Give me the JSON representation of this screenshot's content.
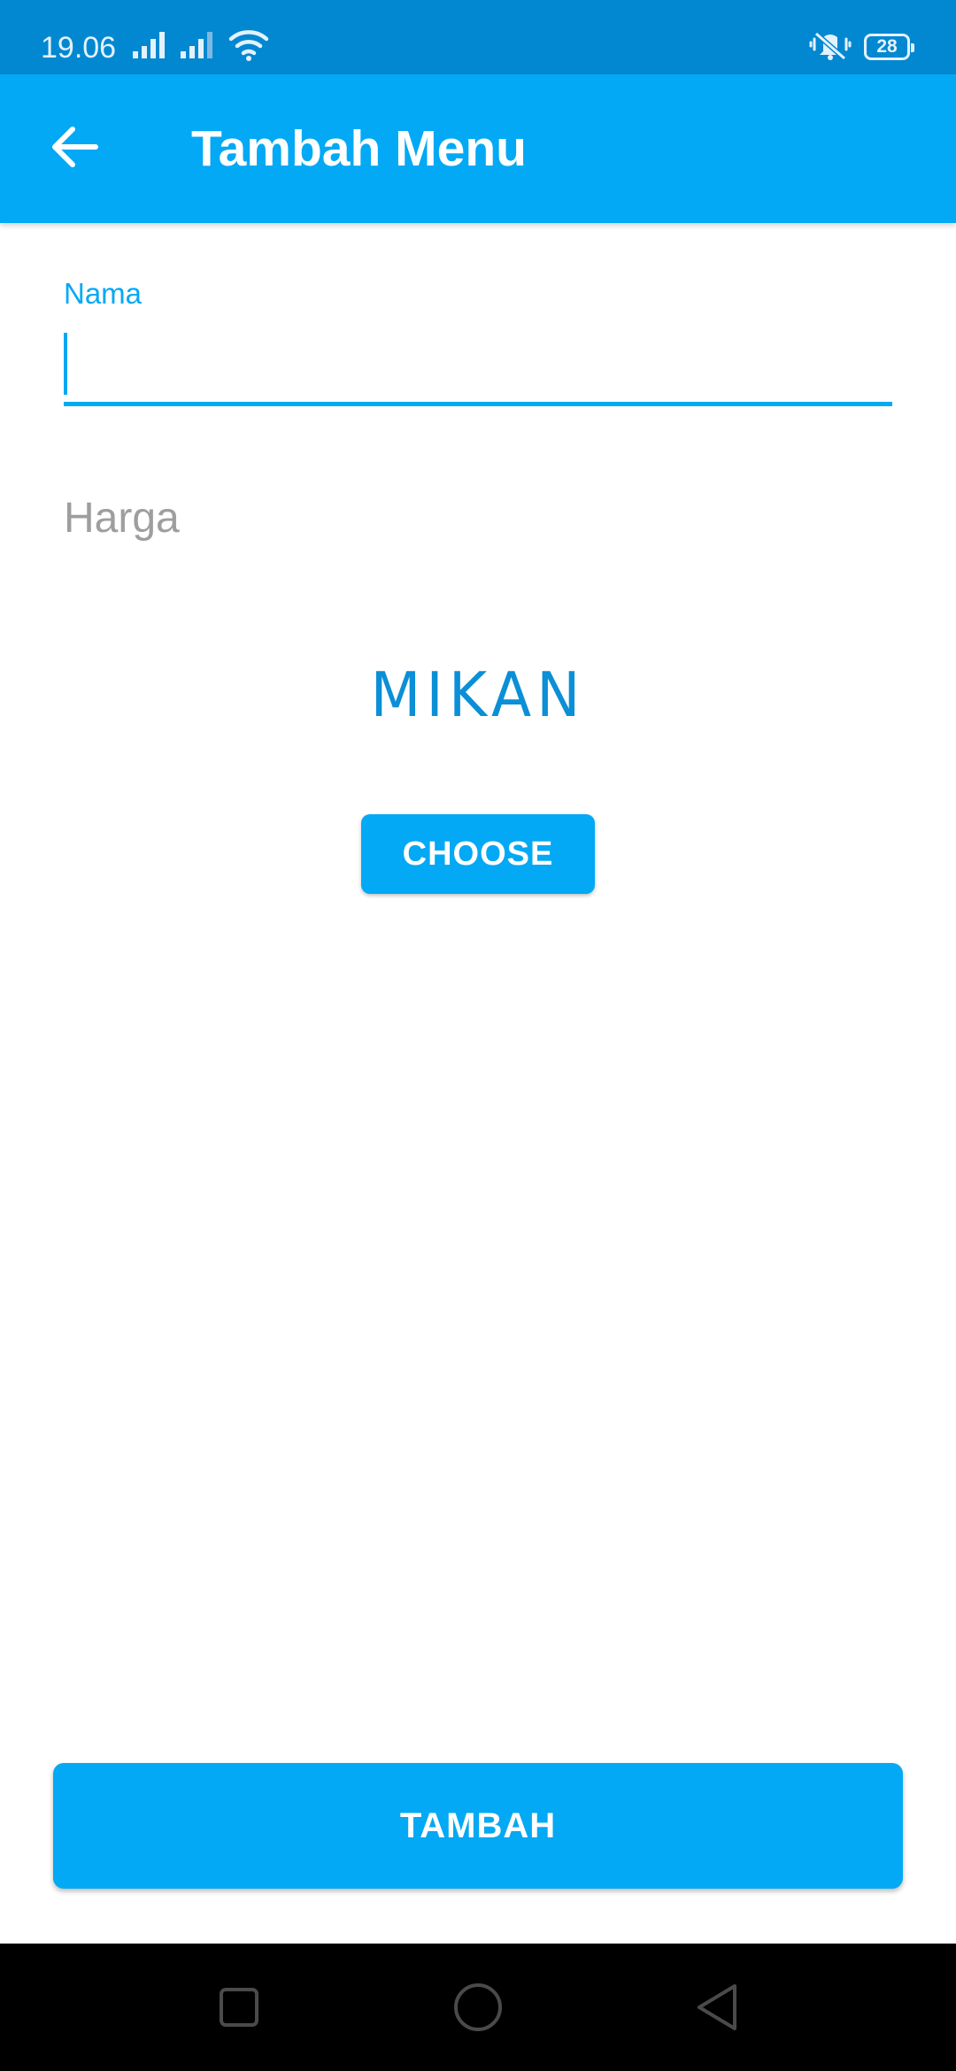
{
  "status_bar": {
    "time": "19.06",
    "battery": "28",
    "icons": [
      "signal-icon",
      "signal-icon",
      "wifi-icon",
      "vibrate-icon",
      "battery-icon"
    ]
  },
  "app_bar": {
    "title": "Tambah Menu",
    "back_icon": "arrow-back-icon",
    "background": "#03a9f4"
  },
  "form": {
    "nama": {
      "label": "Nama",
      "value": ""
    },
    "harga": {
      "placeholder": "Harga",
      "value": ""
    }
  },
  "preview": {
    "text": "MIKAN"
  },
  "buttons": {
    "choose_label": "CHOOSE",
    "tambah_label": "TAMBAH"
  },
  "colors": {
    "accent": "#03a9f4",
    "status_bar": "#0288d1",
    "hint": "#9e9e9e"
  },
  "nav_bar": {
    "icons": [
      "recent-apps-icon",
      "home-icon",
      "back-icon"
    ]
  }
}
